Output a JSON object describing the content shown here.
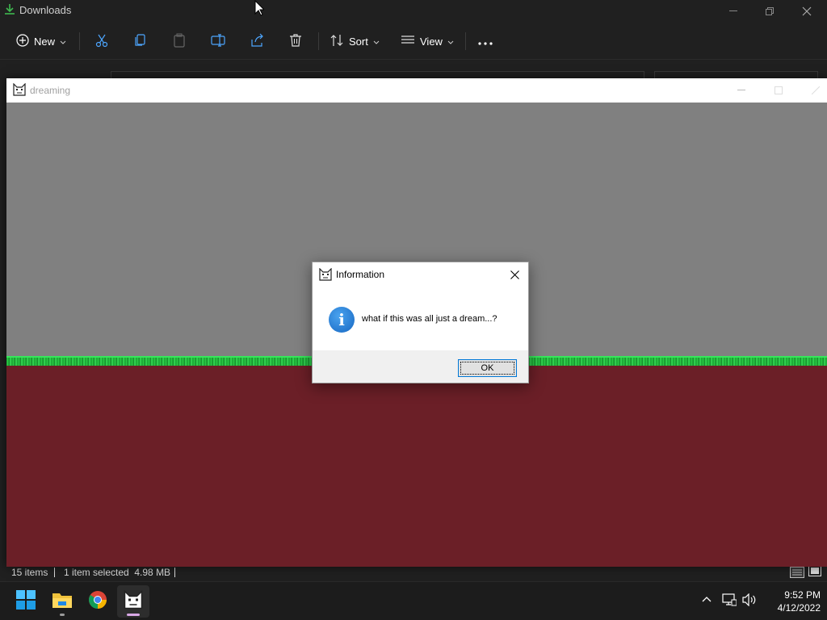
{
  "explorer": {
    "title": "Downloads",
    "toolbar": {
      "new_label": "New",
      "sort_label": "Sort",
      "view_label": "View"
    },
    "status": {
      "item_count": "15 items",
      "selection": "1 item selected  4.98 MB"
    }
  },
  "game_window": {
    "title": "dreaming",
    "colors": {
      "sky": "#808080",
      "grass": "#2ed64a",
      "dirt": "#6b1f27"
    }
  },
  "dialog": {
    "title": "Information",
    "message": "what if this was all just a dream...?",
    "ok_label": "OK",
    "icon": "info-icon"
  },
  "taskbar": {
    "apps": [
      "start-icon",
      "file-explorer-icon",
      "chrome-icon",
      "dreaming-app-icon"
    ],
    "clock": {
      "time": "9:52 PM",
      "date": "4/12/2022"
    }
  }
}
